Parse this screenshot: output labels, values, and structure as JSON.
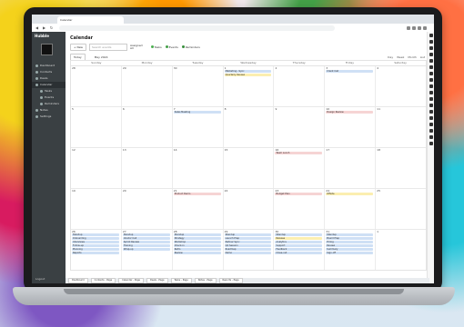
{
  "browser": {
    "tab_title": "Calendar",
    "url": "",
    "back_icon": "arrow-left-icon",
    "forward_icon": "arrow-right-icon",
    "reload_icon": "reload-icon"
  },
  "sidebar": {
    "logo": "Hubble",
    "user_name": "",
    "items": [
      {
        "label": "Dashboard",
        "sub": false,
        "active": false
      },
      {
        "label": "Contacts",
        "sub": false,
        "active": false
      },
      {
        "label": "Deals",
        "sub": false,
        "active": false
      },
      {
        "label": "Calendar",
        "sub": false,
        "active": true
      },
      {
        "label": "Tasks",
        "sub": true,
        "active": false
      },
      {
        "label": "Events",
        "sub": true,
        "active": false
      },
      {
        "label": "Reminders",
        "sub": true,
        "active": false
      },
      {
        "label": "Notes",
        "sub": false,
        "active": false
      },
      {
        "label": "Settings",
        "sub": false,
        "active": false
      }
    ],
    "bottom_label": "Logout"
  },
  "page": {
    "title": "Calendar",
    "add_label": "+ New",
    "search_placeholder": "Search events",
    "filter_label": "Assigned",
    "filter_value": "All",
    "legend": [
      {
        "label": "Tasks",
        "color": "#4caf50"
      },
      {
        "label": "Events",
        "color": "#43a047"
      },
      {
        "label": "Reminders",
        "color": "#388e3c"
      }
    ],
    "today_label": "Today",
    "month_label": "May 2024",
    "views": [
      "Day",
      "Week",
      "Month",
      "List"
    ]
  },
  "calendar": {
    "days": [
      "Sunday",
      "Monday",
      "Tuesday",
      "Wednesday",
      "Thursday",
      "Friday",
      "Saturday"
    ],
    "weeks": [
      [
        {
          "day": "28",
          "events": []
        },
        {
          "day": "29",
          "events": []
        },
        {
          "day": "30",
          "events": []
        },
        {
          "day": "1",
          "events": [
            {
              "t": "Marketing - Sync",
              "c": "blue"
            },
            {
              "t": "Quarterly Review",
              "c": "yellow"
            }
          ]
        },
        {
          "day": "2",
          "events": []
        },
        {
          "day": "3",
          "events": [
            {
              "t": "Client Call",
              "c": "blue"
            }
          ]
        },
        {
          "day": "4",
          "events": []
        }
      ],
      [
        {
          "day": "5",
          "events": []
        },
        {
          "day": "6",
          "events": []
        },
        {
          "day": "7",
          "events": [
            {
              "t": "Sales Meeting",
              "c": "blue"
            }
          ]
        },
        {
          "day": "8",
          "events": []
        },
        {
          "day": "9",
          "events": []
        },
        {
          "day": "10",
          "events": [
            {
              "t": "Design Review",
              "c": "red"
            }
          ]
        },
        {
          "day": "11",
          "events": []
        }
      ],
      [
        {
          "day": "12",
          "events": []
        },
        {
          "day": "13",
          "events": []
        },
        {
          "day": "14",
          "events": []
        },
        {
          "day": "15",
          "events": []
        },
        {
          "day": "16",
          "events": [
            {
              "t": "Team Lunch",
              "c": "red"
            }
          ]
        },
        {
          "day": "17",
          "events": []
        },
        {
          "day": "18",
          "events": []
        }
      ],
      [
        {
          "day": "19",
          "events": []
        },
        {
          "day": "20",
          "events": []
        },
        {
          "day": "21",
          "events": [
            {
              "t": "Product Demo",
              "c": "red"
            }
          ]
        },
        {
          "day": "22",
          "events": []
        },
        {
          "day": "23",
          "events": [
            {
              "t": "Budget Plan",
              "c": "red"
            }
          ]
        },
        {
          "day": "24",
          "events": [
            {
              "t": "Offsite",
              "c": "yellow"
            }
          ]
        },
        {
          "day": "25",
          "events": []
        }
      ],
      [
        {
          "day": "26",
          "events": [
            {
              "t": "Standup",
              "c": "blue"
            },
            {
              "t": "Onboarding",
              "c": "blue"
            },
            {
              "t": "Interviews",
              "c": "blue"
            },
            {
              "t": "Follow-up",
              "c": "blue"
            },
            {
              "t": "Planning",
              "c": "blue"
            },
            {
              "t": "Reports",
              "c": "blue"
            }
          ]
        },
        {
          "day": "27",
          "events": [
            {
              "t": "Standup",
              "c": "blue"
            },
            {
              "t": "Vendor Call",
              "c": "blue"
            },
            {
              "t": "Sprint Review",
              "c": "blue"
            },
            {
              "t": "Training",
              "c": "blue"
            },
            {
              "t": "Wrap-up",
              "c": "blue"
            }
          ]
        },
        {
          "day": "28",
          "events": [
            {
              "t": "Standup",
              "c": "blue"
            },
            {
              "t": "Strategy",
              "c": "blue"
            },
            {
              "t": "Workshop",
              "c": "blue"
            },
            {
              "t": "Check-in",
              "c": "blue"
            },
            {
              "t": "Retro",
              "c": "blue"
            },
            {
              "t": "Review",
              "c": "blue"
            }
          ]
        },
        {
          "day": "29",
          "events": [
            {
              "t": "Standup",
              "c": "blue"
            },
            {
              "t": "Launch Prep",
              "c": "blue"
            },
            {
              "t": "Partner Sync",
              "c": "blue"
            },
            {
              "t": "QA Session",
              "c": "blue"
            },
            {
              "t": "Roadmap",
              "c": "blue"
            },
            {
              "t": "Demo",
              "c": "blue"
            }
          ]
        },
        {
          "day": "30",
          "events": [
            {
              "t": "Standup",
              "c": "blue"
            },
            {
              "t": "Release",
              "c": "yellow"
            },
            {
              "t": "Analytics",
              "c": "blue"
            },
            {
              "t": "Support",
              "c": "blue"
            },
            {
              "t": "Feedback",
              "c": "blue"
            },
            {
              "t": "Close-out",
              "c": "blue"
            }
          ]
        },
        {
          "day": "31",
          "events": [
            {
              "t": "Standup",
              "c": "blue"
            },
            {
              "t": "Board Prep",
              "c": "blue"
            },
            {
              "t": "Hiring",
              "c": "blue"
            },
            {
              "t": "Review",
              "c": "blue"
            },
            {
              "t": "Summary",
              "c": "blue"
            },
            {
              "t": "Sign-off",
              "c": "blue"
            }
          ]
        },
        {
          "day": "1",
          "events": []
        }
      ]
    ]
  },
  "taskbar": [
    "Dashboard",
    "Contacts - Page",
    "Calendar - Page",
    "Deals - Page",
    "Tasks - Page",
    "Notes - Page",
    "Reports - Page"
  ]
}
